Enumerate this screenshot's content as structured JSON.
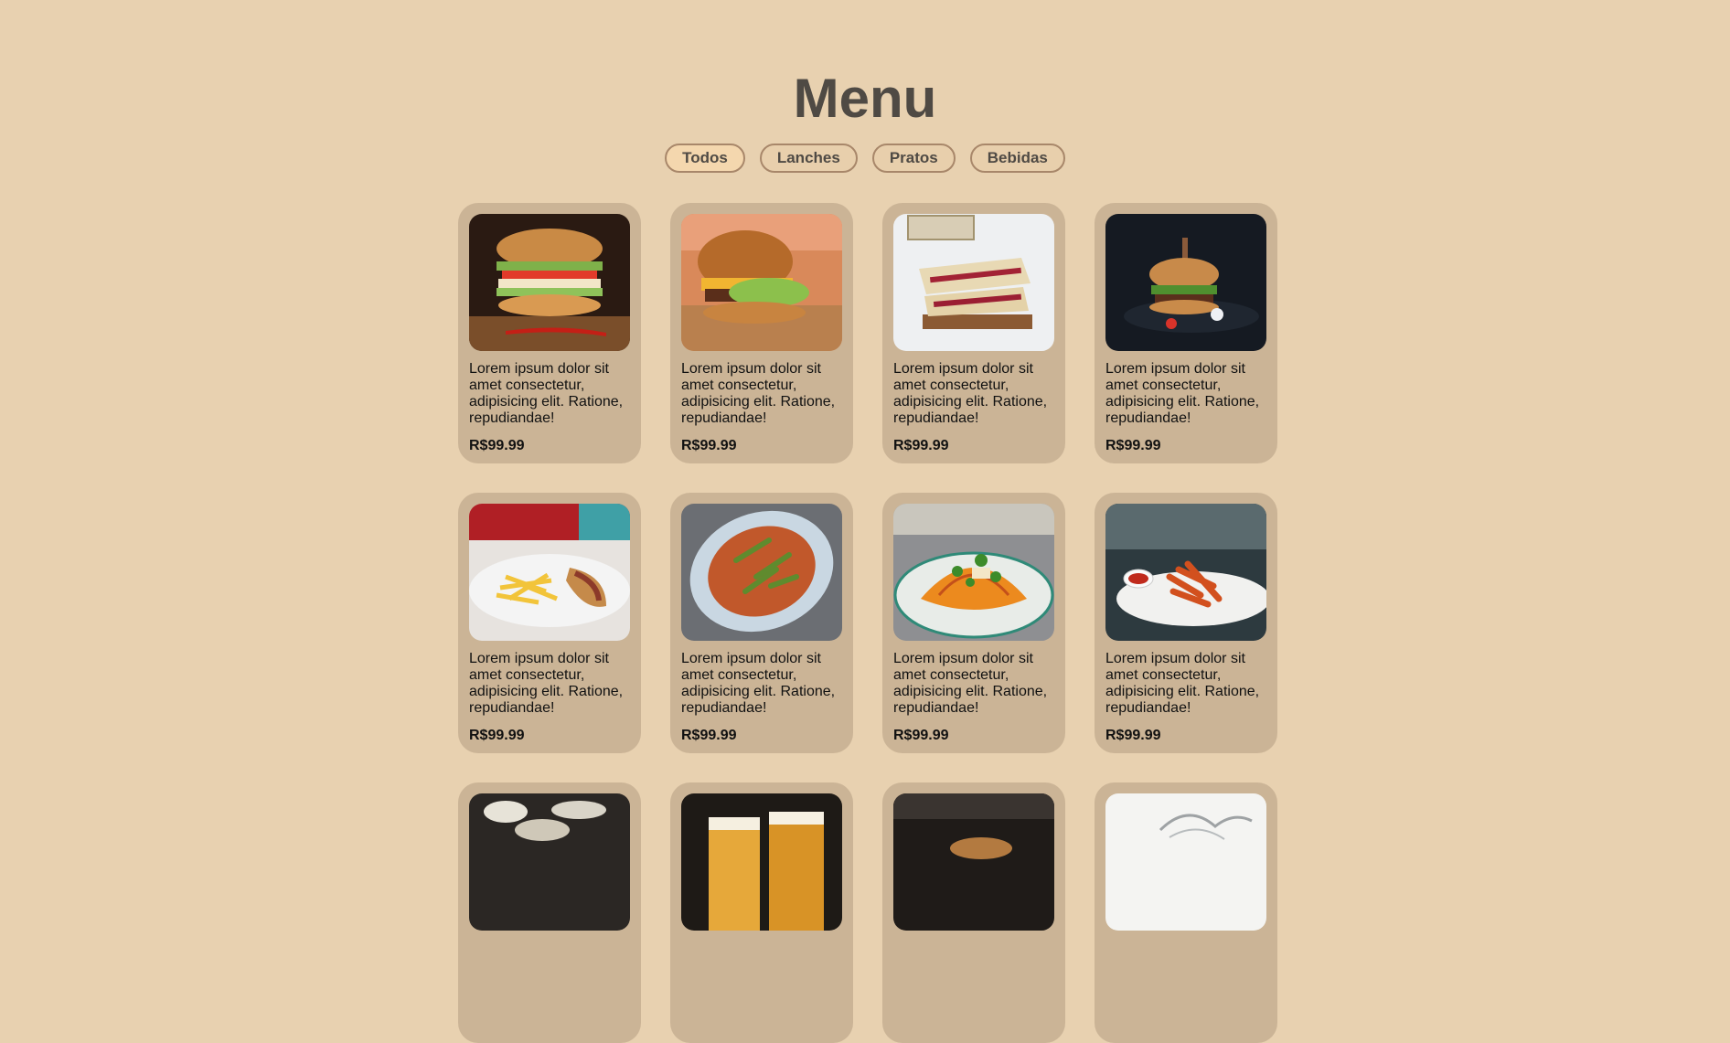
{
  "page": {
    "title": "Menu"
  },
  "filters": [
    {
      "label": "Todos",
      "active": true
    },
    {
      "label": "Lanches",
      "active": false
    },
    {
      "label": "Pratos",
      "active": false
    },
    {
      "label": "Bebidas",
      "active": false
    }
  ],
  "colors": {
    "background": "#e8d1b0",
    "card": "#cbb496",
    "title": "#4f4a44",
    "filter_border": "#a8876a"
  },
  "items": [
    {
      "photo": "burger-stack-photo",
      "description": "Lorem ipsum dolor sit amet consectetur, adipisicing elit. Ratione, repudiandae!",
      "price": "R$99.99"
    },
    {
      "photo": "cheeseburger-photo",
      "description": "Lorem ipsum dolor sit amet consectetur, adipisicing elit. Ratione, repudiandae!",
      "price": "R$99.99"
    },
    {
      "photo": "sandwich-photo",
      "description": "Lorem ipsum dolor sit amet consectetur, adipisicing elit. Ratione, repudiandae!",
      "price": "R$99.99"
    },
    {
      "photo": "burger-dark-photo",
      "description": "Lorem ipsum dolor sit amet consectetur, adipisicing elit. Ratione, repudiandae!",
      "price": "R$99.99"
    },
    {
      "photo": "hotdog-fries-photo",
      "description": "Lorem ipsum dolor sit amet consectetur, adipisicing elit. Ratione, repudiandae!",
      "price": "R$99.99"
    },
    {
      "photo": "okra-dish-photo",
      "description": "Lorem ipsum dolor sit amet consectetur, adipisicing elit. Ratione, repudiandae!",
      "price": "R$99.99"
    },
    {
      "photo": "seafood-shell-photo",
      "description": "Lorem ipsum dolor sit amet consectetur, adipisicing elit. Ratione, repudiandae!",
      "price": "R$99.99"
    },
    {
      "photo": "fried-appetizer-photo",
      "description": "Lorem ipsum dolor sit amet consectetur, adipisicing elit. Ratione, repudiandae!",
      "price": "R$99.99"
    },
    {
      "photo": "drink-photo",
      "description": "",
      "price": ""
    },
    {
      "photo": "beer-glasses-photo",
      "description": "",
      "price": ""
    },
    {
      "photo": "coffee-cup-photo",
      "description": "",
      "price": ""
    },
    {
      "photo": "water-splash-photo",
      "description": "",
      "price": ""
    }
  ]
}
